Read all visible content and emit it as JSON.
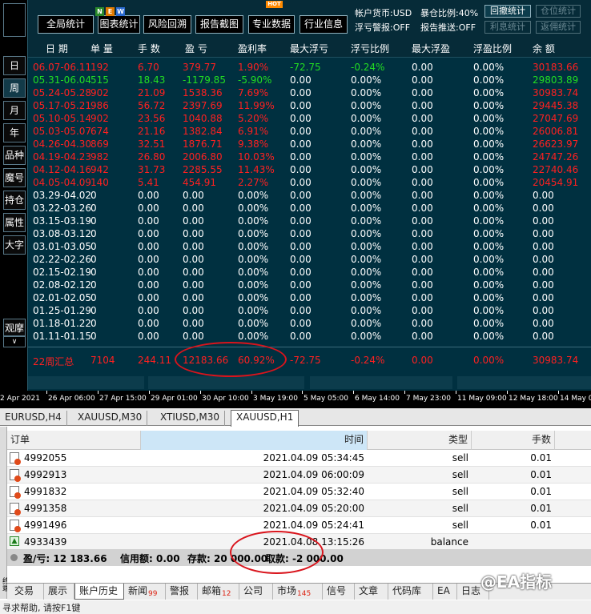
{
  "colors": {
    "profit_red": "#ff2020",
    "profit_green": "#22dd22",
    "neutral": "#ffffff",
    "annotation": "#d9141c"
  },
  "side_rail": [
    "日",
    "周",
    "月",
    "年",
    "品种",
    "魔号",
    "持仓",
    "属性",
    "大字",
    "观摩"
  ],
  "side_rail_arrow": "∨",
  "toolbar": {
    "buttons": [
      "全局统计",
      "图表统计",
      "风险回溯",
      "报告截图",
      "专业数据",
      "行业信息"
    ],
    "new_badge": [
      "N",
      "E",
      "W"
    ],
    "hot_badge": "HOT",
    "info": {
      "currency": "帐户货币:USD",
      "exposure": "暴仓比例:40%",
      "float_alert": "浮亏警报:OFF",
      "report_push": "报告推送:OFF"
    },
    "right_buttons": [
      "回撤统计",
      "仓位统计",
      "利息统计",
      "返佣统计"
    ]
  },
  "table": {
    "columns": [
      "日 期",
      "单 量",
      "手 数",
      "盈 亏",
      "盈利率",
      "最大浮亏",
      "浮亏比例",
      "最大浮盈",
      "浮盈比例",
      "余 额"
    ],
    "rows": [
      {
        "period": "06.07-06.11",
        "orders": "192",
        "lots": "6.70",
        "pnl": "379.77",
        "rate": "1.90%",
        "max_dd": "-72.75",
        "dd_ratio": "-0.24%",
        "max_fp": "0.00",
        "fp_ratio": "0.00%",
        "balance": "30183.66",
        "color": "#ff2020"
      },
      {
        "period": "05.31-06.04",
        "orders": "515",
        "lots": "18.43",
        "pnl": "-1179.85",
        "rate": "-5.90%",
        "max_dd": "0.00",
        "dd_ratio": "0.00%",
        "max_fp": "0.00",
        "fp_ratio": "0.00%",
        "balance": "29803.89",
        "color": "#22dd22"
      },
      {
        "period": "05.24-05.28",
        "orders": "902",
        "lots": "21.09",
        "pnl": "1538.36",
        "rate": "7.69%",
        "max_dd": "0.00",
        "dd_ratio": "0.00%",
        "max_fp": "0.00",
        "fp_ratio": "0.00%",
        "balance": "30983.74",
        "color": "#ff2020"
      },
      {
        "period": "05.17-05.21",
        "orders": "986",
        "lots": "56.72",
        "pnl": "2397.69",
        "rate": "11.99%",
        "max_dd": "0.00",
        "dd_ratio": "0.00%",
        "max_fp": "0.00",
        "fp_ratio": "0.00%",
        "balance": "29445.38",
        "color": "#ff2020"
      },
      {
        "period": "05.10-05.14",
        "orders": "902",
        "lots": "23.56",
        "pnl": "1040.88",
        "rate": "5.20%",
        "max_dd": "0.00",
        "dd_ratio": "0.00%",
        "max_fp": "0.00",
        "fp_ratio": "0.00%",
        "balance": "27047.69",
        "color": "#ff2020"
      },
      {
        "period": "05.03-05.07",
        "orders": "674",
        "lots": "21.16",
        "pnl": "1382.84",
        "rate": "6.91%",
        "max_dd": "0.00",
        "dd_ratio": "0.00%",
        "max_fp": "0.00",
        "fp_ratio": "0.00%",
        "balance": "26006.81",
        "color": "#ff2020"
      },
      {
        "period": "04.26-04.30",
        "orders": "869",
        "lots": "32.51",
        "pnl": "1876.71",
        "rate": "9.38%",
        "max_dd": "0.00",
        "dd_ratio": "0.00%",
        "max_fp": "0.00",
        "fp_ratio": "0.00%",
        "balance": "26623.97",
        "color": "#ff2020"
      },
      {
        "period": "04.19-04.23",
        "orders": "982",
        "lots": "26.80",
        "pnl": "2006.80",
        "rate": "10.03%",
        "max_dd": "0.00",
        "dd_ratio": "0.00%",
        "max_fp": "0.00",
        "fp_ratio": "0.00%",
        "balance": "24747.26",
        "color": "#ff2020"
      },
      {
        "period": "04.12-04.16",
        "orders": "942",
        "lots": "31.73",
        "pnl": "2285.55",
        "rate": "11.43%",
        "max_dd": "0.00",
        "dd_ratio": "0.00%",
        "max_fp": "0.00",
        "fp_ratio": "0.00%",
        "balance": "22740.46",
        "color": "#ff2020"
      },
      {
        "period": "04.05-04.09",
        "orders": "140",
        "lots": "5.41",
        "pnl": "454.91",
        "rate": "2.27%",
        "max_dd": "0.00",
        "dd_ratio": "0.00%",
        "max_fp": "0.00",
        "fp_ratio": "0.00%",
        "balance": "20454.91",
        "color": "#ff2020"
      },
      {
        "period": "03.29-04.02",
        "orders": "0",
        "lots": "0.00",
        "pnl": "0.00",
        "rate": "0.00%",
        "max_dd": "0.00",
        "dd_ratio": "0.00%",
        "max_fp": "0.00",
        "fp_ratio": "0.00%",
        "balance": "0.00",
        "color": "#ffffff"
      },
      {
        "period": "03.22-03.26",
        "orders": "0",
        "lots": "0.00",
        "pnl": "0.00",
        "rate": "0.00%",
        "max_dd": "0.00",
        "dd_ratio": "0.00%",
        "max_fp": "0.00",
        "fp_ratio": "0.00%",
        "balance": "0.00",
        "color": "#ffffff"
      },
      {
        "period": "03.15-03.19",
        "orders": "0",
        "lots": "0.00",
        "pnl": "0.00",
        "rate": "0.00%",
        "max_dd": "0.00",
        "dd_ratio": "0.00%",
        "max_fp": "0.00",
        "fp_ratio": "0.00%",
        "balance": "0.00",
        "color": "#ffffff"
      },
      {
        "period": "03.08-03.12",
        "orders": "0",
        "lots": "0.00",
        "pnl": "0.00",
        "rate": "0.00%",
        "max_dd": "0.00",
        "dd_ratio": "0.00%",
        "max_fp": "0.00",
        "fp_ratio": "0.00%",
        "balance": "0.00",
        "color": "#ffffff"
      },
      {
        "period": "03.01-03.05",
        "orders": "0",
        "lots": "0.00",
        "pnl": "0.00",
        "rate": "0.00%",
        "max_dd": "0.00",
        "dd_ratio": "0.00%",
        "max_fp": "0.00",
        "fp_ratio": "0.00%",
        "balance": "0.00",
        "color": "#ffffff"
      },
      {
        "period": "02.22-02.26",
        "orders": "0",
        "lots": "0.00",
        "pnl": "0.00",
        "rate": "0.00%",
        "max_dd": "0.00",
        "dd_ratio": "0.00%",
        "max_fp": "0.00",
        "fp_ratio": "0.00%",
        "balance": "0.00",
        "color": "#ffffff"
      },
      {
        "period": "02.15-02.19",
        "orders": "0",
        "lots": "0.00",
        "pnl": "0.00",
        "rate": "0.00%",
        "max_dd": "0.00",
        "dd_ratio": "0.00%",
        "max_fp": "0.00",
        "fp_ratio": "0.00%",
        "balance": "0.00",
        "color": "#ffffff"
      },
      {
        "period": "02.08-02.12",
        "orders": "0",
        "lots": "0.00",
        "pnl": "0.00",
        "rate": "0.00%",
        "max_dd": "0.00",
        "dd_ratio": "0.00%",
        "max_fp": "0.00",
        "fp_ratio": "0.00%",
        "balance": "0.00",
        "color": "#ffffff"
      },
      {
        "period": "02.01-02.05",
        "orders": "0",
        "lots": "0.00",
        "pnl": "0.00",
        "rate": "0.00%",
        "max_dd": "0.00",
        "dd_ratio": "0.00%",
        "max_fp": "0.00",
        "fp_ratio": "0.00%",
        "balance": "0.00",
        "color": "#ffffff"
      },
      {
        "period": "01.25-01.29",
        "orders": "0",
        "lots": "0.00",
        "pnl": "0.00",
        "rate": "0.00%",
        "max_dd": "0.00",
        "dd_ratio": "0.00%",
        "max_fp": "0.00",
        "fp_ratio": "0.00%",
        "balance": "0.00",
        "color": "#ffffff"
      },
      {
        "period": "01.18-01.22",
        "orders": "0",
        "lots": "0.00",
        "pnl": "0.00",
        "rate": "0.00%",
        "max_dd": "0.00",
        "dd_ratio": "0.00%",
        "max_fp": "0.00",
        "fp_ratio": "0.00%",
        "balance": "0.00",
        "color": "#ffffff"
      },
      {
        "period": "01.11-01.15",
        "orders": "0",
        "lots": "0.00",
        "pnl": "0.00",
        "rate": "0.00%",
        "max_dd": "0.00",
        "dd_ratio": "0.00%",
        "max_fp": "0.00",
        "fp_ratio": "0.00%",
        "balance": "0.00",
        "color": "#ffffff"
      }
    ],
    "summary": {
      "period": "22周汇总",
      "orders": "7104",
      "lots": "244.11",
      "pnl": "12183.66",
      "rate": "60.92%",
      "max_dd": "-72.75",
      "dd_ratio": "-0.24%",
      "max_fp": "0.00",
      "fp_ratio": "0.00%",
      "balance": "30983.74"
    }
  },
  "time_axis": [
    "2 Apr 2021",
    "26 Apr 06:00",
    "27 Apr 15:00",
    "29 Apr 01:00",
    "30 Apr 10:00",
    "3 May 19:00",
    "5 May 05:00",
    "6 May 14:00",
    "7 May 23:00",
    "11 May 09:00",
    "12 May 18:00",
    "14 May 0"
  ],
  "chart_tabs": [
    "EURUSD,H4",
    "XAUUSD,M30",
    "XTIUSD,M30",
    "XAUUSD,H1"
  ],
  "terminal": {
    "side_label": "终端",
    "columns": [
      "订单",
      "时间",
      "类型",
      "手数"
    ],
    "rows": [
      {
        "order": "4992055",
        "time": "2021.04.09 05:34:45",
        "type": "sell",
        "lots": "0.01"
      },
      {
        "order": "4992913",
        "time": "2021.04.09 06:00:09",
        "type": "sell",
        "lots": "0.01"
      },
      {
        "order": "4991832",
        "time": "2021.04.09 05:32:40",
        "type": "sell",
        "lots": "0.01"
      },
      {
        "order": "4991358",
        "time": "2021.04.09 05:20:00",
        "type": "sell",
        "lots": "0.01"
      },
      {
        "order": "4991496",
        "time": "2021.04.09 05:24:41",
        "type": "sell",
        "lots": "0.01"
      },
      {
        "order": "4933439",
        "time": "2021.04.08 13:15:26",
        "type": "balance",
        "lots": ""
      }
    ],
    "summary": {
      "pnl": "盈/亏: 12 183.66",
      "credit": "信用额: 0.00",
      "deposit": "存款: 20 000.00",
      "withdraw": "取款: -2 000.00"
    },
    "bottom_tabs": [
      {
        "label": "交易",
        "badge": ""
      },
      {
        "label": "展示",
        "badge": ""
      },
      {
        "label": "账户历史",
        "badge": ""
      },
      {
        "label": "新闻",
        "badge": "99"
      },
      {
        "label": "警报",
        "badge": ""
      },
      {
        "label": "邮箱",
        "badge": "12"
      },
      {
        "label": "公司",
        "badge": ""
      },
      {
        "label": "市场",
        "badge": "145"
      },
      {
        "label": "信号",
        "badge": ""
      },
      {
        "label": "文章",
        "badge": ""
      },
      {
        "label": "代码库",
        "badge": ""
      },
      {
        "label": "EA",
        "badge": ""
      },
      {
        "label": "日志",
        "badge": ""
      }
    ],
    "status": "寻求帮助, 请按F1键"
  },
  "watermark": "@EA指标"
}
